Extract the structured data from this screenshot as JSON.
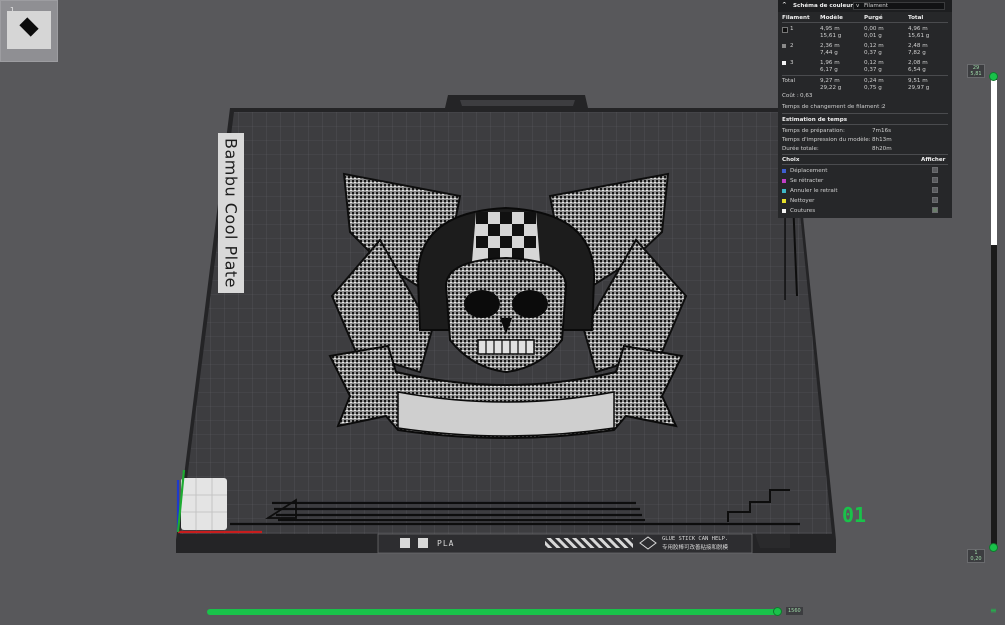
{
  "thumbnail": {
    "number": "1"
  },
  "plate": {
    "name": "Bambu Cool Plate",
    "number": "01",
    "strip_material": "PLA",
    "strip_note": "GLUE STICK CAN HELP.",
    "strip_note_cn": "专用胶棒可改善粘接和脱模"
  },
  "panel": {
    "title": "Schéma de couleur",
    "scheme_value": "Filament",
    "headers": {
      "filament": "Filament",
      "model": "Modèle",
      "purged": "Purgé",
      "total": "Total"
    },
    "rows": [
      {
        "id": "1",
        "color": "#111111",
        "model_m": "4,95 m",
        "model_g": "15,61 g",
        "purged_m": "0,00 m",
        "purged_g": "0,01 g",
        "total_m": "4,96 m",
        "total_g": "15,61 g"
      },
      {
        "id": "2",
        "color": "#8a8a8a",
        "model_m": "2,36 m",
        "model_g": "7,44 g",
        "purged_m": "0,12 m",
        "purged_g": "0,37 g",
        "total_m": "2,48 m",
        "total_g": "7,82 g"
      },
      {
        "id": "3",
        "color": "#f2f2f2",
        "model_m": "1,96 m",
        "model_g": "6,17 g",
        "purged_m": "0,12 m",
        "purged_g": "0,37 g",
        "total_m": "2,08 m",
        "total_g": "6,54 g"
      }
    ],
    "total": {
      "label": "Total",
      "model_m": "9,27 m",
      "model_g": "29,22 g",
      "purged_m": "0,24 m",
      "purged_g": "0,75 g",
      "total_m": "9,51 m",
      "total_g": "29,97 g"
    },
    "cost_label": "Coût :",
    "cost_value": "0,63",
    "change_time_label": "Temps de changement de filament :",
    "change_time_value": "2",
    "time_estimate_title": "Estimation de temps",
    "prep_label": "Temps de préparation:",
    "prep_value": "7m16s",
    "print_label": "Temps d'impression du modèle:",
    "print_value": "8h13m",
    "total_time_label": "Durée totale:",
    "total_time_value": "8h20m",
    "choice_header": "Choix",
    "show_header": "Afficher",
    "options": [
      {
        "label": "Déplacement",
        "color": "#3e5fd0",
        "checked": false
      },
      {
        "label": "Se rétracter",
        "color": "#c13fc6",
        "checked": false
      },
      {
        "label": "Annuler le retrait",
        "color": "#3fb8c6",
        "checked": false
      },
      {
        "label": "Nettoyer",
        "color": "#e6df2b",
        "checked": false
      },
      {
        "label": "Coutures",
        "color": "#f2f2f2",
        "checked": true
      }
    ]
  },
  "layer_slider": {
    "top_label": "29\n5,81",
    "bottom_label": "1\n0,20"
  },
  "move_slider": {
    "end_label": "1560"
  }
}
